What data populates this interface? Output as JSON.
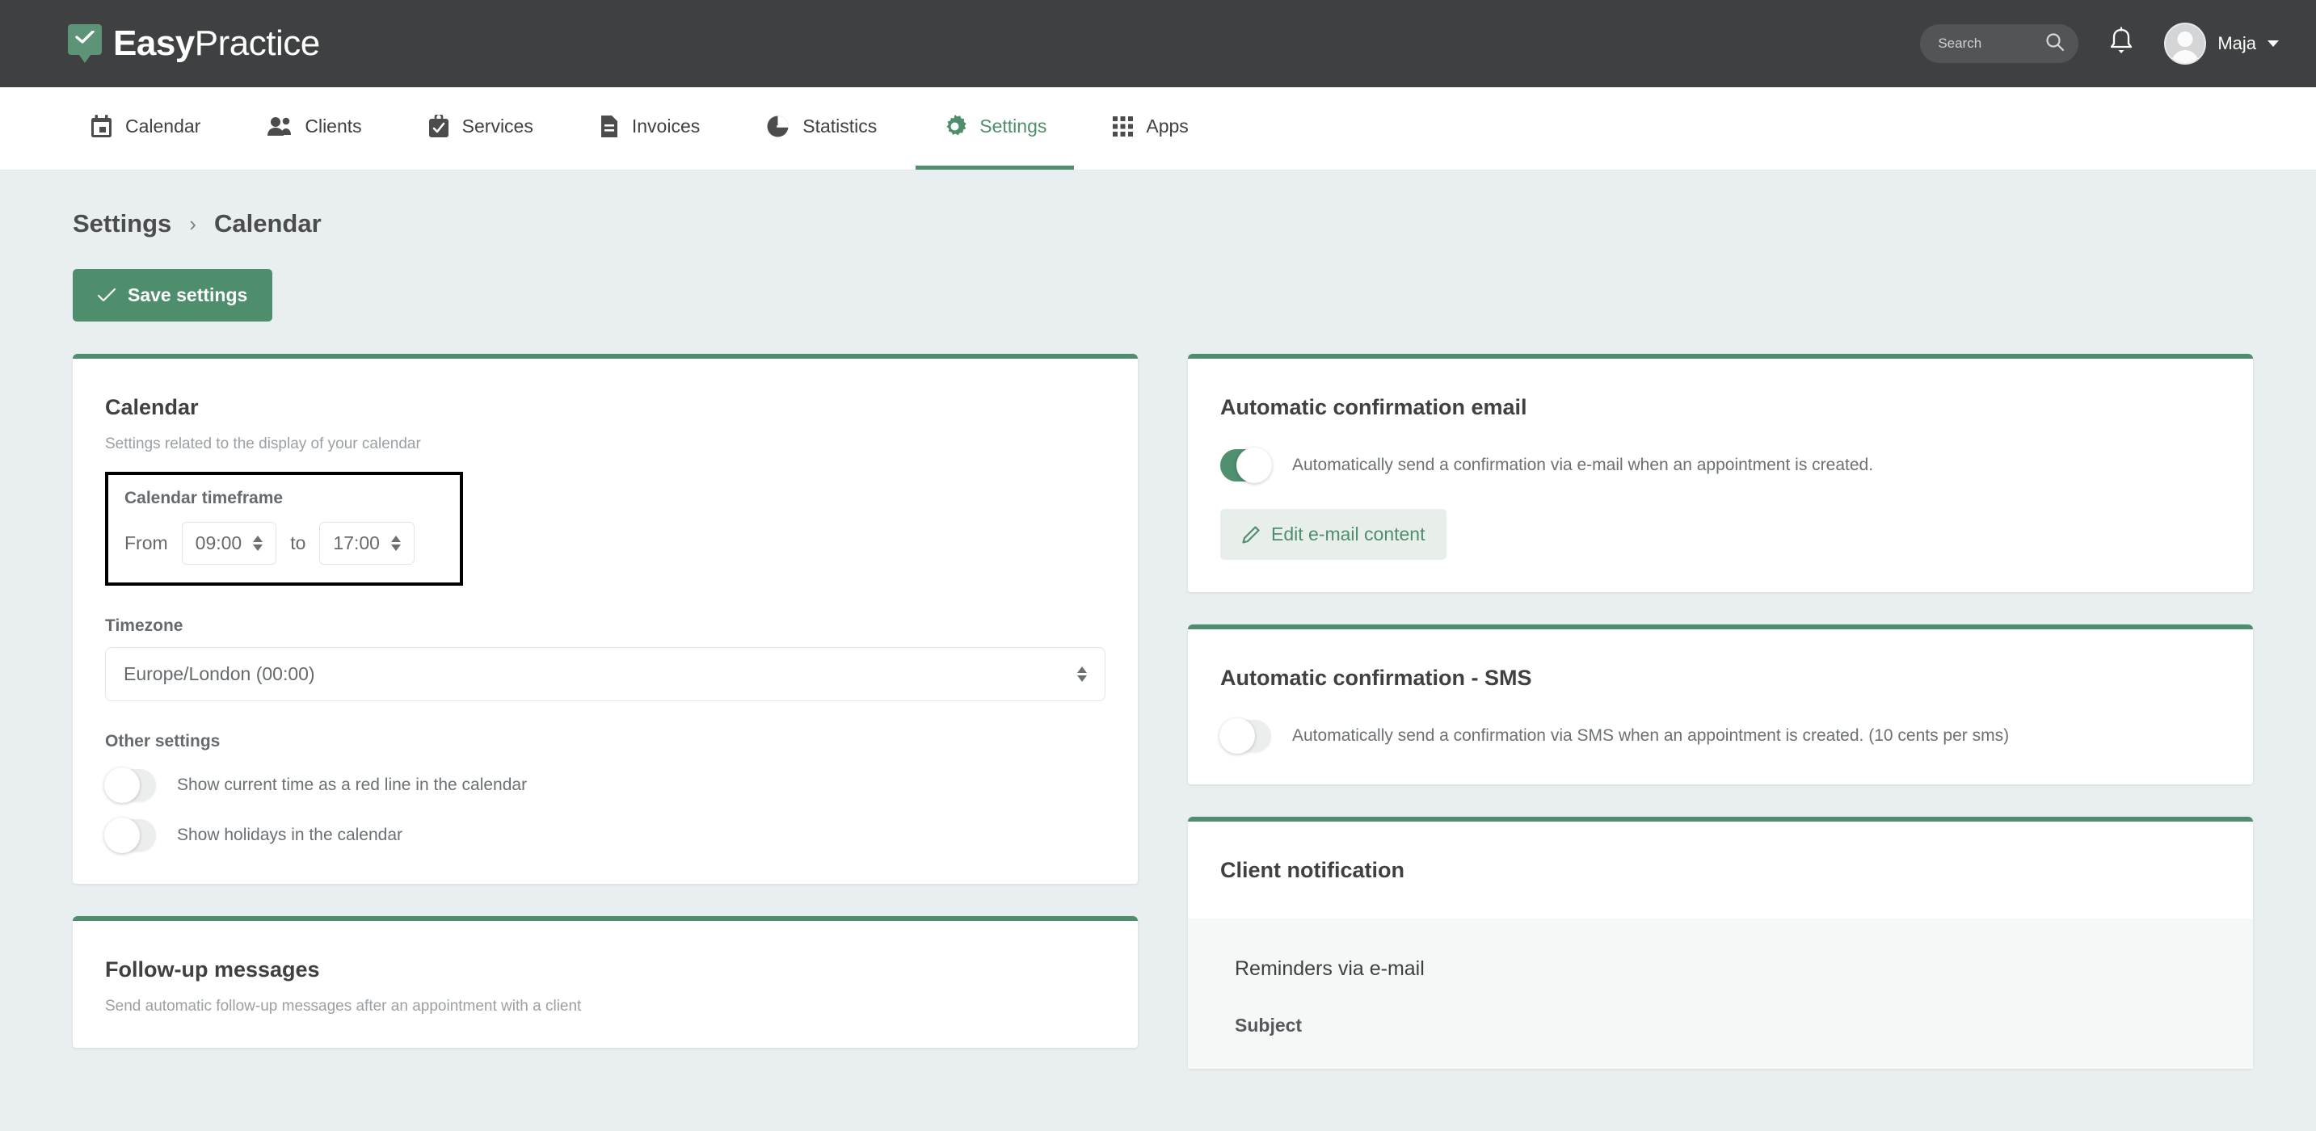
{
  "topbar": {
    "brand_bold": "Easy",
    "brand_light": "Practice",
    "search_placeholder": "Search",
    "search_value": "",
    "user_name": "Maja"
  },
  "nav": {
    "items": [
      {
        "label": "Calendar",
        "icon": "calendar-icon",
        "active": false
      },
      {
        "label": "Clients",
        "icon": "clients-icon",
        "active": false
      },
      {
        "label": "Services",
        "icon": "services-icon",
        "active": false
      },
      {
        "label": "Invoices",
        "icon": "invoices-icon",
        "active": false
      },
      {
        "label": "Statistics",
        "icon": "statistics-icon",
        "active": false
      },
      {
        "label": "Settings",
        "icon": "gear-icon",
        "active": true
      },
      {
        "label": "Apps",
        "icon": "apps-grid-icon",
        "active": false
      }
    ]
  },
  "breadcrumb": {
    "parent": "Settings",
    "separator": "›",
    "current": "Calendar"
  },
  "toolbar": {
    "save_label": "Save settings"
  },
  "left_column": {
    "calendar_card": {
      "title": "Calendar",
      "subtitle": "Settings related to the display of your calendar",
      "timeframe": {
        "label": "Calendar timeframe",
        "from_label": "From",
        "from_value": "09:00",
        "to_label": "to",
        "to_value": "17:00"
      },
      "timezone": {
        "label": "Timezone",
        "value": "Europe/London (00:00)"
      },
      "other": {
        "label": "Other settings",
        "toggles": [
          {
            "label": "Show current time as a red line in the calendar",
            "on": false
          },
          {
            "label": "Show holidays in the calendar",
            "on": false
          }
        ]
      }
    },
    "followup_card": {
      "title": "Follow-up messages",
      "subtitle": "Send automatic follow-up messages after an appointment with a client"
    }
  },
  "right_column": {
    "confirmation_email_card": {
      "title": "Automatic confirmation email",
      "toggle_label": "Automatically send a confirmation via e-mail when an appointment is created.",
      "toggle_on": true,
      "edit_button": "Edit e-mail content"
    },
    "confirmation_sms_card": {
      "title": "Automatic confirmation - SMS",
      "toggle_label": "Automatically send a confirmation via SMS when an appointment is created. (10 cents per sms)",
      "toggle_on": false
    },
    "client_notification_card": {
      "title": "Client notification",
      "panel_title": "Reminders via e-mail",
      "subject_label": "Subject"
    }
  },
  "colors": {
    "brand_green": "#4e8e6d",
    "topbar_dark": "#3f4041",
    "page_bg": "#e9eef0",
    "highlight_outline": "#000000"
  }
}
